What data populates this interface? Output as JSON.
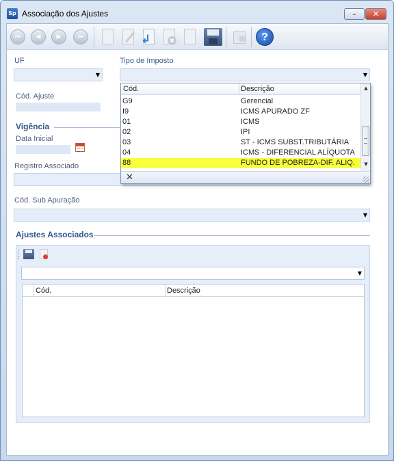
{
  "window": {
    "icon_text": "Sp",
    "title": "Associação dos Ajustes",
    "minimize_glyph": "–",
    "close_glyph": "✕"
  },
  "toolbar": {
    "icons": [
      "first-record-icon",
      "previous-record-icon",
      "next-record-icon",
      "last-record-icon",
      "new-document-icon",
      "edit-document-icon",
      "undo-icon",
      "cancel-icon",
      "redo-icon",
      "save-icon",
      "lock-icon",
      "help-icon"
    ],
    "first_glyph": "⏮",
    "prev_glyph": "◀",
    "next_glyph": "▶",
    "last_glyph": "⏭",
    "help_glyph": "?"
  },
  "form": {
    "uf_label": "UF",
    "uf_value": "",
    "tipo_imposto_label": "Tipo de Imposto",
    "tipo_imposto_value": "",
    "cod_ajuste_label": "Cód. Ajuste",
    "vigencia_label": "Vigência",
    "data_inicial_label": "Data Inicial",
    "registro_associado_label": "Registro Associado",
    "cod_sub_apuracao_label": "Cód. Sub Apuração",
    "combo_arrow": "▼"
  },
  "dropdown": {
    "columns": [
      "Cód.",
      "Descrição"
    ],
    "rows": [
      {
        "cod": "G9",
        "descricao": "Gerencial"
      },
      {
        "cod": "I9",
        "descricao": "ICMS APURADO ZF"
      },
      {
        "cod": "01",
        "descricao": "ICMS"
      },
      {
        "cod": "02",
        "descricao": "IPI"
      },
      {
        "cod": "03",
        "descricao": "ST - ICMS SUBST.TRIBUTÁRIA"
      },
      {
        "cod": "04",
        "descricao": "ICMS - DIFERENCIAL ALÍQUOTA"
      },
      {
        "cod": "88",
        "descricao": "FUNDO DE POBREZA-DIF. ALIQ."
      }
    ],
    "selected_index": 6,
    "clear_glyph": "✕",
    "scroll_up": "▲",
    "scroll_down": "▼",
    "highlight_color": "#f8ff3c"
  },
  "ajustes": {
    "section_label": "Ajustes Associados",
    "columns": [
      "Cód.",
      "Descrição"
    ],
    "combo_arrow": "▼"
  }
}
